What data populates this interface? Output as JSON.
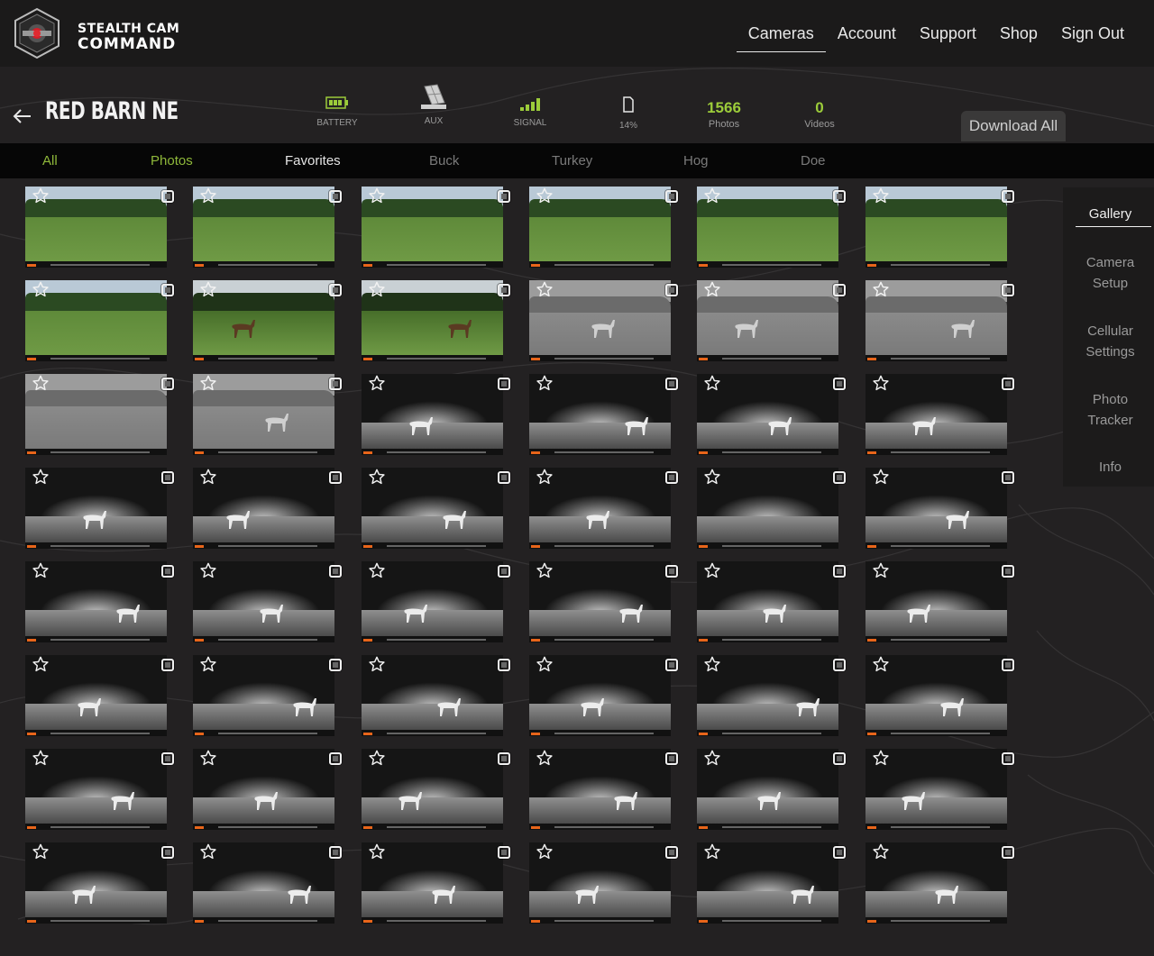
{
  "header": {
    "logo_line1": "STEALTH CAM",
    "logo_line2": "COMMAND",
    "nav": [
      {
        "label": "Cameras",
        "active": true
      },
      {
        "label": "Account",
        "active": false
      },
      {
        "label": "Support",
        "active": false
      },
      {
        "label": "Shop",
        "active": false
      },
      {
        "label": "Sign Out",
        "active": false
      }
    ]
  },
  "camera": {
    "title": "RED BARN NE",
    "battery_label": "BATTERY",
    "aux_label": "AUX",
    "signal_label": "SIGNAL",
    "storage_value": "14%",
    "photos_count": "1566",
    "photos_label": "Photos",
    "videos_count": "0",
    "videos_label": "Videos",
    "download_label": "Download All",
    "accent_color": "#9ccc3a"
  },
  "filters": [
    {
      "label": "All",
      "style": "green"
    },
    {
      "label": "Photos",
      "style": "green"
    },
    {
      "label": "Favorites",
      "style": "white"
    },
    {
      "label": "Buck",
      "style": "dim"
    },
    {
      "label": "Turkey",
      "style": "dim"
    },
    {
      "label": "Hog",
      "style": "dim"
    },
    {
      "label": "Doe",
      "style": "dim"
    }
  ],
  "side_menu": [
    {
      "label": "Gallery",
      "active": true
    },
    {
      "label": "Camera\nSetup",
      "active": false
    },
    {
      "label": "Cellular\nSettings",
      "active": false
    },
    {
      "label": "Photo\nTracker",
      "active": false
    },
    {
      "label": "Info",
      "active": false
    }
  ],
  "gallery": {
    "rows": [
      [
        "day",
        "day",
        "day",
        "day",
        "day",
        "day"
      ],
      [
        "day",
        "dusk",
        "dusk",
        "gray",
        "gray",
        "gray"
      ],
      [
        "gray",
        "gray",
        "night",
        "night",
        "night",
        "night"
      ],
      [
        "night",
        "night",
        "night",
        "night",
        "night",
        "night"
      ],
      [
        "night",
        "night",
        "night",
        "night",
        "night",
        "night"
      ],
      [
        "night",
        "night",
        "night",
        "night",
        "night",
        "night"
      ],
      [
        "night",
        "night",
        "night",
        "night",
        "night",
        "night"
      ],
      [
        "night",
        "night",
        "night",
        "night",
        "night",
        "night"
      ]
    ],
    "deer": [
      [
        0,
        0,
        0,
        0,
        0,
        0
      ],
      [
        0,
        1,
        1,
        1,
        1,
        1
      ],
      [
        0,
        1,
        1,
        1,
        1,
        1
      ],
      [
        1,
        1,
        1,
        1,
        0,
        1
      ],
      [
        1,
        1,
        1,
        1,
        1,
        1
      ],
      [
        1,
        1,
        1,
        1,
        1,
        1
      ],
      [
        1,
        1,
        1,
        1,
        1,
        1
      ],
      [
        1,
        1,
        1,
        1,
        1,
        1
      ]
    ],
    "icons": {
      "favorite": "star-outline-icon",
      "select": "checkbox-icon"
    }
  }
}
